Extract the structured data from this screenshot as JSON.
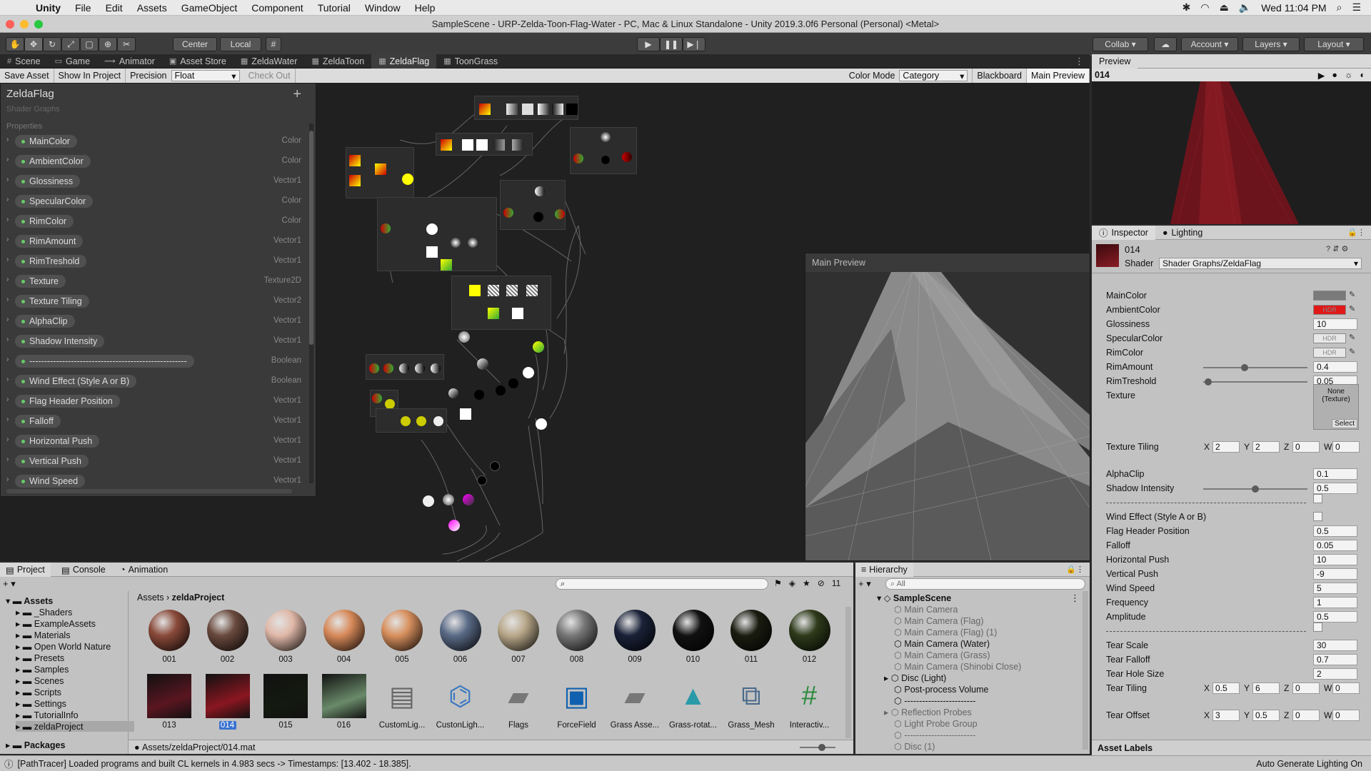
{
  "menubar": {
    "app": "Unity",
    "items": [
      "File",
      "Edit",
      "Assets",
      "GameObject",
      "Component",
      "Tutorial",
      "Window",
      "Help"
    ],
    "clock": "Wed 11:04 PM"
  },
  "titlebar": {
    "title": "SampleScene - URP-Zelda-Toon-Flag-Water - PC, Mac & Linux Standalone - Unity 2019.3.0f6 Personal (Personal) <Metal>"
  },
  "toolbar": {
    "center": "Center",
    "local": "Local",
    "collab": "Collab",
    "account": "Account",
    "layers": "Layers",
    "layout": "Layout"
  },
  "tabs": [
    {
      "label": "Scene",
      "icon": "#"
    },
    {
      "label": "Game",
      "icon": "▭"
    },
    {
      "label": "Animator",
      "icon": "⟿"
    },
    {
      "label": "Asset Store",
      "icon": "▣"
    },
    {
      "label": "ZeldaWater",
      "icon": "▦"
    },
    {
      "label": "ZeldaToon",
      "icon": "▦"
    },
    {
      "label": "ZeldaFlag",
      "icon": "▦"
    },
    {
      "label": "ToonGrass",
      "icon": "▦"
    }
  ],
  "graph_toolbar": {
    "save": "Save Asset",
    "show": "Show In Project",
    "precision_label": "Precision",
    "precision": "Float",
    "checkout": "Check Out",
    "color_mode_label": "Color Mode",
    "color_mode": "Category",
    "blackboard": "Blackboard",
    "main_preview": "Main Preview"
  },
  "blackboard": {
    "title": "ZeldaFlag",
    "subtitle": "Shader Graphs",
    "properties_label": "Properties",
    "properties": [
      {
        "name": "MainColor",
        "type": "Color"
      },
      {
        "name": "AmbientColor",
        "type": "Color"
      },
      {
        "name": "Glossiness",
        "type": "Vector1"
      },
      {
        "name": "SpecularColor",
        "type": "Color"
      },
      {
        "name": "RimColor",
        "type": "Color"
      },
      {
        "name": "RimAmount",
        "type": "Vector1"
      },
      {
        "name": "RimTreshold",
        "type": "Vector1"
      },
      {
        "name": "Texture",
        "type": "Texture2D"
      },
      {
        "name": "Texture Tiling",
        "type": "Vector2"
      },
      {
        "name": "AlphaClip",
        "type": "Vector1"
      },
      {
        "name": "Shadow Intensity",
        "type": "Vector1"
      },
      {
        "name": "-----------------------------------------------------",
        "type": "Boolean"
      },
      {
        "name": "Wind Effect (Style A or B)",
        "type": "Boolean"
      },
      {
        "name": "Flag Header Position",
        "type": "Vector1"
      },
      {
        "name": "Falloff",
        "type": "Vector1"
      },
      {
        "name": "Horizontal Push",
        "type": "Vector1"
      },
      {
        "name": "Vertical Push",
        "type": "Vector1"
      },
      {
        "name": "Wind Speed",
        "type": "Vector1"
      }
    ]
  },
  "main_preview": {
    "title": "Main Preview"
  },
  "preview_panel": {
    "tab": "Preview",
    "name": "014"
  },
  "inspector": {
    "tab_inspector": "Inspector",
    "tab_lighting": "Lighting",
    "material": "014",
    "shader_label": "Shader",
    "shader": "Shader Graphs/ZeldaFlag",
    "rows": [
      {
        "label": "MainColor",
        "kind": "color",
        "color": "#7a7a7a"
      },
      {
        "label": "AmbientColor",
        "kind": "color",
        "color": "#e01818",
        "hdr": "HDR"
      },
      {
        "label": "Glossiness",
        "kind": "field",
        "value": "10"
      },
      {
        "label": "SpecularColor",
        "kind": "color",
        "color": "#e8e8e8",
        "hdr": "HDR"
      },
      {
        "label": "RimColor",
        "kind": "color",
        "color": "#e8e8e8",
        "hdr": "HDR"
      },
      {
        "label": "RimAmount",
        "kind": "slider",
        "value": "0.4",
        "pos": 0.4
      },
      {
        "label": "RimTreshold",
        "kind": "slider",
        "value": "0.05",
        "pos": 0.05
      },
      {
        "label": "Texture",
        "kind": "texture",
        "none": "None",
        "type": "(Texture)",
        "select": "Select"
      },
      {
        "label": "Texture Tiling",
        "kind": "vec4",
        "x": "2",
        "y": "2",
        "z": "0",
        "w": "0"
      },
      {
        "label": "AlphaClip",
        "kind": "field",
        "value": "0.1"
      },
      {
        "label": "Shadow Intensity",
        "kind": "slider",
        "value": "0.5",
        "pos": 0.5
      },
      {
        "label": "",
        "kind": "dashcheck"
      },
      {
        "label": "Wind Effect (Style A or B)",
        "kind": "check"
      },
      {
        "label": "Flag Header Position",
        "kind": "field",
        "value": "0.5"
      },
      {
        "label": "Falloff",
        "kind": "field",
        "value": "0.05"
      },
      {
        "label": "Horizontal Push",
        "kind": "field",
        "value": "10"
      },
      {
        "label": "Vertical Push",
        "kind": "field",
        "value": "-9"
      },
      {
        "label": "Wind Speed",
        "kind": "field",
        "value": "5"
      },
      {
        "label": "Frequency",
        "kind": "field",
        "value": "1"
      },
      {
        "label": "Amplitude",
        "kind": "field",
        "value": "0.5"
      },
      {
        "label": "",
        "kind": "dashcheck"
      },
      {
        "label": "Tear Scale",
        "kind": "field",
        "value": "30"
      },
      {
        "label": "Tear Falloff",
        "kind": "field",
        "value": "0.7"
      },
      {
        "label": "Tear Hole Size",
        "kind": "field",
        "value": "2"
      },
      {
        "label": "Tear Tiling",
        "kind": "vec4",
        "x": "0.5",
        "y": "6",
        "z": "0",
        "w": "0"
      },
      {
        "label": "Tear Offset",
        "kind": "vec4",
        "x": "3",
        "y": "0.5",
        "z": "0",
        "w": "0"
      }
    ],
    "asset_labels": "Asset Labels"
  },
  "project": {
    "tabs": [
      "Project",
      "Console",
      "Animation"
    ],
    "count": "11",
    "breadcrumb": [
      "Assets",
      "zeldaProject"
    ],
    "tree": [
      {
        "label": "Assets",
        "level": 0,
        "bold": true
      },
      {
        "label": "_Shaders",
        "level": 1
      },
      {
        "label": "ExampleAssets",
        "level": 1
      },
      {
        "label": "Materials",
        "level": 1
      },
      {
        "label": "Open World Nature",
        "level": 1
      },
      {
        "label": "Presets",
        "level": 1
      },
      {
        "label": "Samples",
        "level": 1
      },
      {
        "label": "Scenes",
        "level": 1
      },
      {
        "label": "Scripts",
        "level": 1
      },
      {
        "label": "Settings",
        "level": 1
      },
      {
        "label": "TutorialInfo",
        "level": 1
      },
      {
        "label": "zeldaProject",
        "level": 1,
        "selected": true
      },
      {
        "label": "Packages",
        "level": 0,
        "bold": true
      }
    ],
    "assets": [
      {
        "label": "001",
        "kind": "sphere",
        "color": "#8a4a3a"
      },
      {
        "label": "002",
        "kind": "sphere",
        "color": "#6a4a3e"
      },
      {
        "label": "003",
        "kind": "sphere",
        "color": "#e0b8a8"
      },
      {
        "label": "004",
        "kind": "sphere",
        "color": "#d88a5a"
      },
      {
        "label": "005",
        "kind": "sphere",
        "color": "#d8905e"
      },
      {
        "label": "006",
        "kind": "sphere",
        "color": "#5a6a86"
      },
      {
        "label": "007",
        "kind": "sphere",
        "color": "#b8a88a"
      },
      {
        "label": "008",
        "kind": "sphere",
        "color": "#777"
      },
      {
        "label": "009",
        "kind": "sphere",
        "color": "#1a2238"
      },
      {
        "label": "010",
        "kind": "sphere",
        "color": "#111"
      },
      {
        "label": "011",
        "kind": "sphere",
        "color": "#1a1c10"
      },
      {
        "label": "012",
        "kind": "sphere",
        "color": "#2e3a1a"
      },
      {
        "label": "013",
        "kind": "flag",
        "color": "#5a1620"
      },
      {
        "label": "014",
        "kind": "flag",
        "color": "#8a1620",
        "selected": true
      },
      {
        "label": "015",
        "kind": "flag",
        "color": "#141a10"
      },
      {
        "label": "016",
        "kind": "flag",
        "color": "#6a8a6a"
      },
      {
        "label": "CustomLig...",
        "kind": "doc"
      },
      {
        "label": "CustonLigh...",
        "kind": "graph"
      },
      {
        "label": "Flags",
        "kind": "folder"
      },
      {
        "label": "ForceField",
        "kind": "force"
      },
      {
        "label": "Grass Asse...",
        "kind": "folder"
      },
      {
        "label": "Grass-rotat...",
        "kind": "mesh"
      },
      {
        "label": "Grass_Mesh",
        "kind": "prefab"
      },
      {
        "label": "Interactiv...",
        "kind": "script"
      }
    ],
    "path": "Assets/zeldaProject/014.mat"
  },
  "hierarchy": {
    "tab": "Hierarchy",
    "search": "All",
    "scene": "SampleScene",
    "items": [
      {
        "label": "Main Camera",
        "dim": true
      },
      {
        "label": "Main Camera (Flag)",
        "dim": true
      },
      {
        "label": "Main Camera (Flag) (1)",
        "dim": true
      },
      {
        "label": "Main Camera (Water)",
        "dim": false
      },
      {
        "label": "Main Camera (Grass)",
        "dim": true
      },
      {
        "label": "Main Camera (Shinobi Close)",
        "dim": true
      },
      {
        "label": "Disc (Light)",
        "dim": false,
        "arrow": true
      },
      {
        "label": "Post-process Volume",
        "dim": false
      },
      {
        "label": "------------------------",
        "dim": false
      },
      {
        "label": "Reflection Probes",
        "dim": true,
        "arrow": true
      },
      {
        "label": "Light Probe Group",
        "dim": true
      },
      {
        "label": "------------------------",
        "dim": true
      },
      {
        "label": "Disc (1)",
        "dim": true
      }
    ]
  },
  "status": {
    "message": "[PathTracer] Loaded programs and built CL kernels in 4.983 secs -> Timestamps: [13.402 - 18.385].",
    "right": "Auto Generate Lighting On"
  }
}
